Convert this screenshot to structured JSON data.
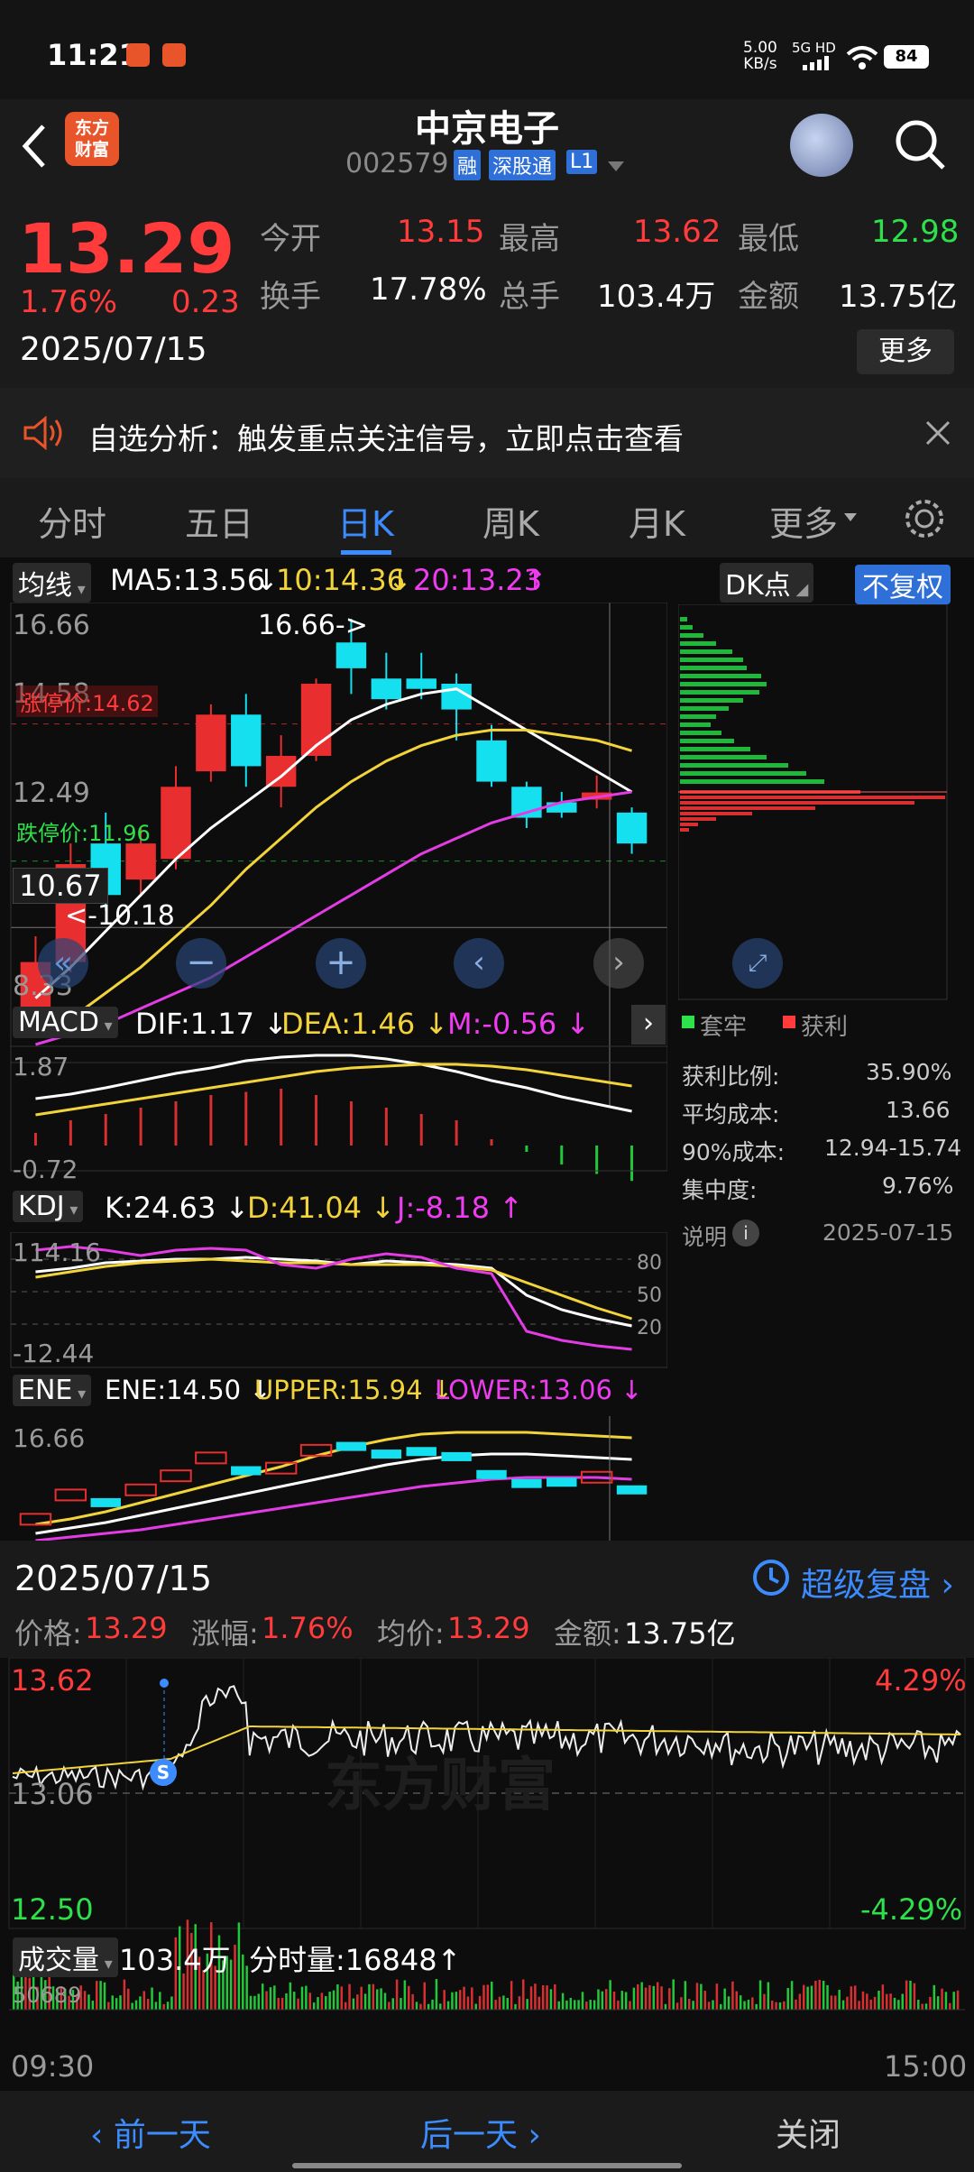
{
  "status": {
    "time": "11:21",
    "speed_top": "5.00",
    "speed_unit": "KB/s",
    "net": "5G HD",
    "battery": "84"
  },
  "header": {
    "title": "中京电子",
    "code": "002579",
    "tag_rong": "融",
    "tag_sgt": "深股通",
    "tag_l1": "L1",
    "logo_line1": "东方",
    "logo_line2": "财富"
  },
  "quote": {
    "price": "13.29",
    "pct": "1.76%",
    "chg": "0.23",
    "date": "2025/07/15",
    "open_label": "今开",
    "open": "13.15",
    "high_label": "最高",
    "high": "13.62",
    "low_label": "最低",
    "low": "12.98",
    "turn_label": "换手",
    "turn": "17.78%",
    "vol_label": "总手",
    "vol": "103.4万",
    "amt_label": "金额",
    "amt": "13.75亿",
    "more": "更多"
  },
  "banner": {
    "text": "自选分析：触发重点关注信号，立即点击查看"
  },
  "tabs": [
    "分时",
    "五日",
    "日K",
    "周K",
    "月K",
    "更多"
  ],
  "tabs_active": 2,
  "kline": {
    "ma_select": "均线",
    "ma5": "MA5:13.56",
    "ma10": "10:14.36",
    "ma20": "20:13.23",
    "dk": "DK点",
    "fq": "不复权",
    "y_top": "16.66",
    "y_2": "14.58",
    "y_3": "12.49",
    "y_bottom": "8.33",
    "limit_up": "涨停价:14.62",
    "limit_down": "跌停价:11.96",
    "crosshair": "10.67",
    "hi_mark": "16.66",
    "lo_mark": "10.18"
  },
  "chip": {
    "legend_trap": "套牢",
    "legend_profit": "获利",
    "profit_ratio_label": "获利比例:",
    "profit_ratio": "35.90%",
    "avg_cost_label": "平均成本:",
    "avg_cost": "13.66",
    "cost90_label": "90%成本:",
    "cost90": "12.94-15.74",
    "conc_label": "集中度:",
    "conc": "9.76%",
    "note_label": "说明",
    "note_date": "2025-07-15"
  },
  "macd": {
    "name": "MACD",
    "dif": "DIF:1.17",
    "dea": "DEA:1.46",
    "m": "M:-0.56",
    "y_top": "1.87",
    "y_bottom": "-0.72"
  },
  "kdj": {
    "name": "KDJ",
    "k": "K:24.63",
    "d": "D:41.04",
    "j": "J:-8.18",
    "y_top": "114.16",
    "y_bottom": "-12.44",
    "l80": "80",
    "l50": "50",
    "l20": "20"
  },
  "ene": {
    "name": "ENE",
    "ene": "ENE:14.50",
    "upper": "UPPER:15.94",
    "lower": "LOWER:13.06",
    "y_top": "16.66"
  },
  "intraday": {
    "date": "2025/07/15",
    "replay": "超级复盘",
    "price_label": "价格:",
    "price": "13.29",
    "pct_label": "涨幅:",
    "pct": "1.76%",
    "avg_label": "均价:",
    "avg": "13.29",
    "amt_label": "金额:",
    "amt": "13.75亿",
    "y_top": "13.62",
    "y_mid": "13.06",
    "y_bot": "12.50",
    "pct_top": "4.29%",
    "pct_bot": "-4.29%",
    "s_mark": "S",
    "vol_select": "成交量",
    "vol": "103.4万",
    "tick_vol": "分时量:16848",
    "vol_top": "50689",
    "t_start": "09:30",
    "t_end": "15:00",
    "watermark": "东方财富"
  },
  "bottom": {
    "prev": "前一天",
    "next": "后一天",
    "close": "关闭"
  },
  "chart_data": {
    "type": "candlestick",
    "title": "日K",
    "ylim": [
      8.33,
      16.66
    ],
    "candles": [
      {
        "o": 9.0,
        "c": 10.0,
        "h": 10.5,
        "l": 8.6,
        "dir": "up"
      },
      {
        "o": 10.0,
        "c": 11.9,
        "h": 12.3,
        "l": 9.8,
        "dir": "up"
      },
      {
        "o": 12.3,
        "c": 11.3,
        "h": 12.9,
        "l": 11.0,
        "dir": "down"
      },
      {
        "o": 11.6,
        "c": 12.3,
        "h": 12.6,
        "l": 11.3,
        "dir": "up"
      },
      {
        "o": 12.0,
        "c": 13.4,
        "h": 13.8,
        "l": 11.8,
        "dir": "up"
      },
      {
        "o": 13.7,
        "c": 14.8,
        "h": 15.0,
        "l": 13.5,
        "dir": "up"
      },
      {
        "o": 14.8,
        "c": 13.8,
        "h": 15.2,
        "l": 13.4,
        "dir": "down"
      },
      {
        "o": 13.4,
        "c": 14.0,
        "h": 14.4,
        "l": 13.0,
        "dir": "up"
      },
      {
        "o": 14.0,
        "c": 15.4,
        "h": 15.5,
        "l": 13.9,
        "dir": "up"
      },
      {
        "o": 16.2,
        "c": 15.7,
        "h": 16.66,
        "l": 15.2,
        "dir": "down"
      },
      {
        "o": 15.5,
        "c": 15.1,
        "h": 16.0,
        "l": 14.9,
        "dir": "down"
      },
      {
        "o": 15.5,
        "c": 15.3,
        "h": 16.0,
        "l": 15.1,
        "dir": "down"
      },
      {
        "o": 15.4,
        "c": 14.9,
        "h": 15.6,
        "l": 14.3,
        "dir": "down"
      },
      {
        "o": 14.3,
        "c": 13.5,
        "h": 14.6,
        "l": 13.4,
        "dir": "down"
      },
      {
        "o": 13.4,
        "c": 12.8,
        "h": 13.5,
        "l": 12.6,
        "dir": "down"
      },
      {
        "o": 13.1,
        "c": 12.9,
        "h": 13.3,
        "l": 12.8,
        "dir": "down"
      },
      {
        "o": 13.15,
        "c": 13.29,
        "h": 13.62,
        "l": 12.98,
        "dir": "up"
      },
      {
        "o": 12.9,
        "c": 12.3,
        "h": 13.0,
        "l": 12.1,
        "dir": "down"
      }
    ],
    "ma5": [
      9.3,
      9.9,
      10.6,
      11.3,
      12.0,
      12.6,
      13.1,
      13.6,
      14.2,
      14.7,
      15.0,
      15.2,
      15.3,
      14.9,
      14.5,
      14.1,
      13.7,
      13.3
    ],
    "ma10": [
      8.6,
      8.9,
      9.4,
      9.9,
      10.5,
      11.1,
      11.8,
      12.4,
      13.0,
      13.5,
      13.9,
      14.2,
      14.4,
      14.5,
      14.5,
      14.4,
      14.3,
      14.1
    ],
    "ma20": [
      8.4,
      8.6,
      8.8,
      9.1,
      9.4,
      9.7,
      10.1,
      10.5,
      10.9,
      11.3,
      11.7,
      12.1,
      12.4,
      12.7,
      12.9,
      13.1,
      13.2,
      13.3
    ],
    "macd_hist": [
      0.2,
      0.4,
      0.5,
      0.6,
      0.7,
      0.8,
      0.85,
      0.9,
      0.8,
      0.7,
      0.6,
      0.5,
      0.4,
      0.1,
      -0.1,
      -0.3,
      -0.45,
      -0.56
    ]
  }
}
